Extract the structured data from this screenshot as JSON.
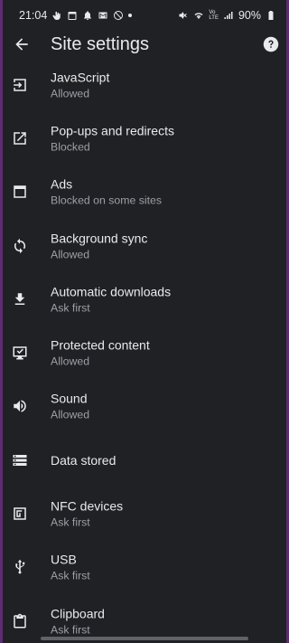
{
  "status_bar": {
    "time": "21:04",
    "network_label": "VoLTE",
    "battery": "90%"
  },
  "app_bar": {
    "title": "Site settings"
  },
  "settings": [
    {
      "label": "JavaScript",
      "status": "Allowed",
      "icon": "javascript-icon"
    },
    {
      "label": "Pop-ups and redirects",
      "status": "Blocked",
      "icon": "open-external-icon"
    },
    {
      "label": "Ads",
      "status": "Blocked on some sites",
      "icon": "ads-window-icon"
    },
    {
      "label": "Background sync",
      "status": "Allowed",
      "icon": "sync-icon"
    },
    {
      "label": "Automatic downloads",
      "status": "Ask first",
      "icon": "download-icon"
    },
    {
      "label": "Protected content",
      "status": "Allowed",
      "icon": "protected-content-icon"
    },
    {
      "label": "Sound",
      "status": "Allowed",
      "icon": "speaker-icon"
    },
    {
      "label": "Data stored",
      "status": "",
      "icon": "storage-icon"
    },
    {
      "label": "NFC devices",
      "status": "Ask first",
      "icon": "nfc-icon"
    },
    {
      "label": "USB",
      "status": "Ask first",
      "icon": "usb-icon"
    },
    {
      "label": "Clipboard",
      "status": "Ask first",
      "icon": "clipboard-icon"
    }
  ]
}
